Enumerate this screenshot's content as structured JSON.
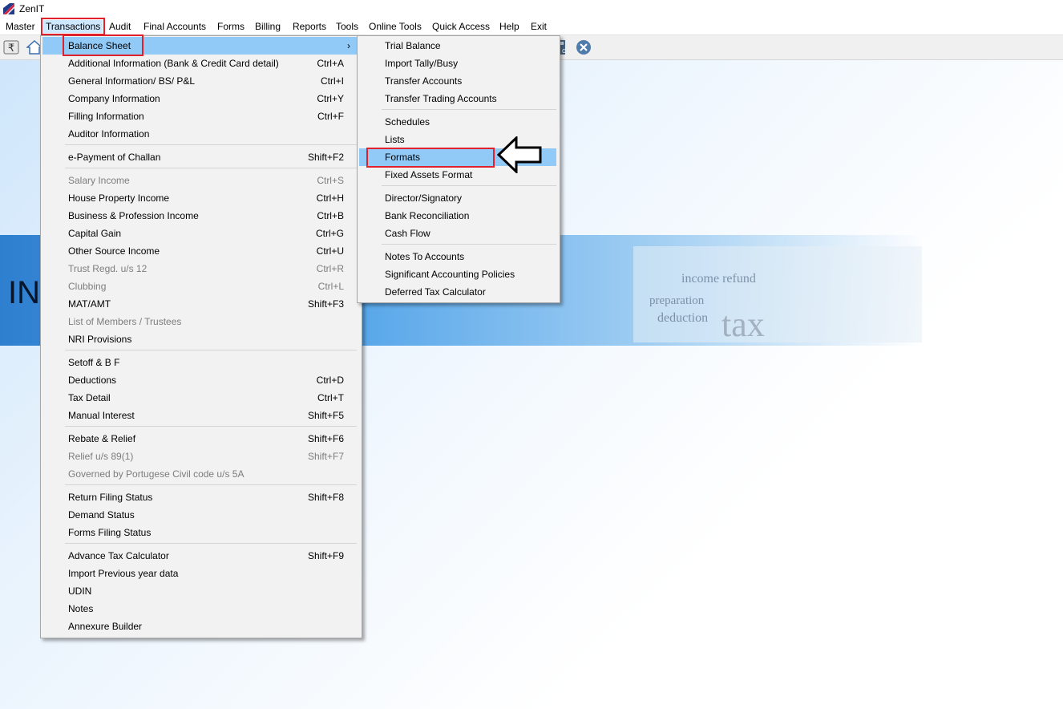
{
  "window": {
    "title": "ZenIT"
  },
  "menubar": {
    "items": [
      "Master",
      "Transactions",
      "Audit",
      "Final Accounts",
      "Forms",
      "Billing",
      "Reports",
      "Tools",
      "Online Tools",
      "Quick Access",
      "Help",
      "Exit"
    ],
    "active": "Transactions"
  },
  "toolbar": {
    "icons": [
      "rupee-icon",
      "home-icon",
      "calculator-icon",
      "close-icon"
    ]
  },
  "banner": {
    "text": "INC"
  },
  "transactions_menu": {
    "items": [
      {
        "label": "Balance Sheet",
        "shortcut": "",
        "submenu": true,
        "highlighted": true
      },
      {
        "label": "Additional Information (Bank & Credit Card detail)",
        "shortcut": "Ctrl+A"
      },
      {
        "label": "General Information/ BS/ P&L",
        "shortcut": "Ctrl+I"
      },
      {
        "label": "Company Information",
        "shortcut": "Ctrl+Y"
      },
      {
        "label": "Filling Information",
        "shortcut": "Ctrl+F"
      },
      {
        "label": "Auditor Information",
        "shortcut": ""
      },
      {
        "label": "e-Payment of Challan",
        "shortcut": "Shift+F2"
      },
      {
        "label": "Salary Income",
        "shortcut": "Ctrl+S",
        "disabled": true
      },
      {
        "label": "House Property Income",
        "shortcut": "Ctrl+H"
      },
      {
        "label": "Business & Profession Income",
        "shortcut": "Ctrl+B"
      },
      {
        "label": "Capital Gain",
        "shortcut": "Ctrl+G"
      },
      {
        "label": "Other Source Income",
        "shortcut": "Ctrl+U"
      },
      {
        "label": "Trust Regd. u/s 12",
        "shortcut": "Ctrl+R",
        "disabled": true
      },
      {
        "label": "Clubbing",
        "shortcut": "Ctrl+L",
        "disabled": true
      },
      {
        "label": "MAT/AMT",
        "shortcut": "Shift+F3"
      },
      {
        "label": "List of Members / Trustees",
        "shortcut": "",
        "disabled": true
      },
      {
        "label": "NRI Provisions",
        "shortcut": ""
      },
      {
        "label": "Setoff & B F",
        "shortcut": ""
      },
      {
        "label": "Deductions",
        "shortcut": "Ctrl+D"
      },
      {
        "label": "Tax Detail",
        "shortcut": "Ctrl+T"
      },
      {
        "label": "Manual Interest",
        "shortcut": "Shift+F5"
      },
      {
        "label": "Rebate & Relief",
        "shortcut": "Shift+F6"
      },
      {
        "label": "Relief u/s 89(1)",
        "shortcut": "Shift+F7",
        "disabled": true
      },
      {
        "label": "Governed by Portugese Civil code u/s 5A",
        "shortcut": "",
        "disabled": true
      },
      {
        "label": "Return Filing Status",
        "shortcut": "Shift+F8"
      },
      {
        "label": "Demand Status",
        "shortcut": ""
      },
      {
        "label": "Forms Filing Status",
        "shortcut": ""
      },
      {
        "label": "Advance Tax Calculator",
        "shortcut": "Shift+F9"
      },
      {
        "label": "Import Previous year data",
        "shortcut": ""
      },
      {
        "label": "UDIN",
        "shortcut": ""
      },
      {
        "label": "Notes",
        "shortcut": ""
      },
      {
        "label": "Annexure Builder",
        "shortcut": ""
      }
    ]
  },
  "balance_sheet_submenu": {
    "items": [
      {
        "label": "Trial Balance"
      },
      {
        "label": "Import Tally/Busy"
      },
      {
        "label": "Transfer Accounts"
      },
      {
        "label": "Transfer Trading Accounts"
      },
      {
        "label": "Schedules"
      },
      {
        "label": "Lists"
      },
      {
        "label": "Formats",
        "highlighted": true
      },
      {
        "label": "Fixed Assets Format"
      },
      {
        "label": "Director/Signatory"
      },
      {
        "label": "Bank Reconciliation"
      },
      {
        "label": "Cash Flow"
      },
      {
        "label": "Notes To Accounts"
      },
      {
        "label": "Significant Accounting Policies"
      },
      {
        "label": "Deferred Tax Calculator"
      }
    ]
  },
  "colors": {
    "highlight": "#91c9f7",
    "annotation": "#e0202a",
    "disabled_text": "#7d7d7d"
  }
}
